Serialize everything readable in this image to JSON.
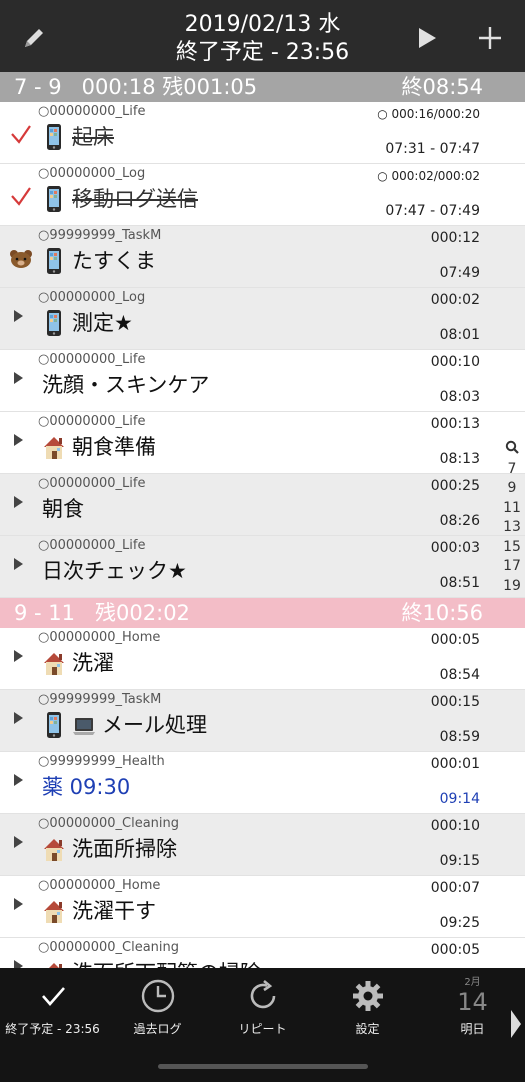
{
  "header": {
    "date": "2019/02/13 水",
    "end_estimate": "終了予定 - 23:56"
  },
  "sections": [
    {
      "label": "7 - 9   000:18 残001:05",
      "end": "終08:54",
      "color": "#a5a5a5"
    },
    {
      "label": "9 - 11   残002:02",
      "end": "終10:56",
      "color": "#f3bdc7"
    }
  ],
  "tasks": [
    {
      "project": "00000000_Life",
      "name": "起床",
      "duration": "000:16/000:20",
      "time": "07:31 - 07:47",
      "icon": "phone-icon",
      "done": true,
      "row": "white"
    },
    {
      "project": "00000000_Log",
      "name": "移動ログ送信",
      "duration": "000:02/000:02",
      "time": "07:47 - 07:49",
      "icon": "phone-icon",
      "done": true,
      "row": "white"
    },
    {
      "project": "99999999_TaskM",
      "name": "たすくま",
      "duration": "000:12",
      "time": "07:49",
      "icon": "phone-icon",
      "lead": "bear-icon",
      "row": "gray"
    },
    {
      "project": "00000000_Log",
      "name": "測定★",
      "duration": "000:02",
      "time": "08:01",
      "icon": "phone-icon",
      "row": "gray"
    },
    {
      "project": "00000000_Life",
      "name": "洗顔・スキンケア",
      "duration": "000:10",
      "time": "08:03",
      "row": "white"
    },
    {
      "project": "00000000_Life",
      "name": "朝食準備",
      "duration": "000:13",
      "time": "08:13",
      "icon": "house-icon",
      "row": "white"
    },
    {
      "project": "00000000_Life",
      "name": "朝食",
      "duration": "000:25",
      "time": "08:26",
      "row": "gray"
    },
    {
      "project": "00000000_Life",
      "name": "日次チェック★",
      "duration": "000:03",
      "time": "08:51",
      "row": "gray"
    },
    {
      "project": "00000000_Home",
      "name": "洗濯",
      "duration": "000:05",
      "time": "08:54",
      "icon": "house-icon",
      "row": "white"
    },
    {
      "project": "99999999_TaskM",
      "name": "メール処理",
      "duration": "000:15",
      "time": "08:59",
      "icon": "phone-icon",
      "icon2": "laptop-icon",
      "row": "gray"
    },
    {
      "project": "99999999_Health",
      "name": "薬 09:30",
      "duration": "000:01",
      "time": "09:14",
      "blue": true,
      "row": "white"
    },
    {
      "project": "00000000_Cleaning",
      "name": "洗面所掃除",
      "duration": "000:10",
      "time": "09:15",
      "icon": "house-icon",
      "row": "gray"
    },
    {
      "project": "00000000_Home",
      "name": "洗濯干す",
      "duration": "000:07",
      "time": "09:25",
      "icon": "house-icon",
      "row": "white"
    },
    {
      "project": "00000000_Cleaning",
      "name": "洗面所下配管の掃除",
      "duration": "000:05",
      "time": "",
      "icon": "house-icon",
      "row": "white"
    }
  ],
  "index": [
    "7",
    "9",
    "11",
    "13",
    "15",
    "17",
    "19"
  ],
  "tabbar": {
    "tabs": [
      {
        "label": "終了予定 - 23:56",
        "icon": "check-icon"
      },
      {
        "label": "過去ログ",
        "icon": "clock-icon"
      },
      {
        "label": "リピート",
        "icon": "repeat-icon"
      },
      {
        "label": "設定",
        "icon": "gear-icon"
      },
      {
        "label": "明日",
        "icon": "calendar-icon"
      }
    ],
    "calendar_month": "2月",
    "calendar_day": "14"
  }
}
